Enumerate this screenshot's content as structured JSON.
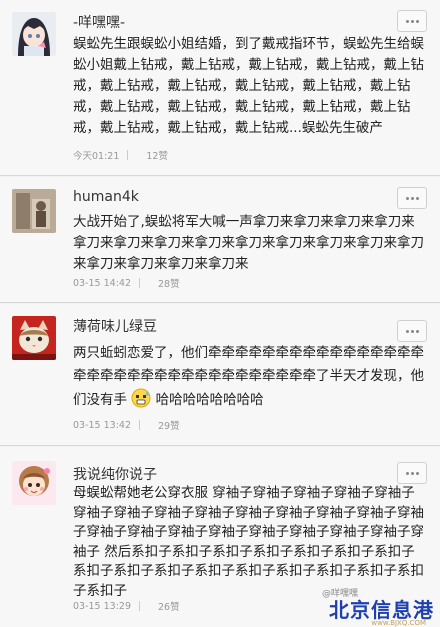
{
  "posts": [
    {
      "username": "-咩嘿嘿-",
      "content": "蜈蚣先生跟蜈蚣小姐结婚，到了戴戒指环节，蜈蚣先生给蜈蚣小姐戴上钻戒，戴上钻戒，戴上钻戒，戴上钻戒，戴上钻戒，戴上钻戒，戴上钻戒，戴上钻戒，戴上钻戒，戴上钻戒，戴上钻戒，戴上钻戒，戴上钻戒，戴上钻戒，戴上钻戒，戴上钻戒，戴上钻戒，戴上钻戒...蜈蚣先生破产",
      "time": "今天01:21",
      "likes": "12赞"
    },
    {
      "username": "human4k",
      "content": "大战开始了,蜈蚣将军大喊一声拿刀来拿刀来拿刀来拿刀来拿刀来拿刀来拿刀来拿刀来拿刀来拿刀来拿刀来拿刀来拿刀来拿刀来拿刀来拿刀来拿刀来",
      "time": "03-15 14:42",
      "likes": "28赞"
    },
    {
      "username": "薄荷味儿绿豆",
      "content_before": "两只蚯蚓恋爱了，他们牵牵牵牵牵牵牵牵牵牵牵牵牵牵牵牵牵牵牵牵牵牵牵牵牵牵牵牵牵牵牵牵牵牵了半天才发现，他们没有手",
      "content_after": "哈哈哈哈哈哈哈哈",
      "time": "03-15 13:42",
      "likes": "29赞"
    },
    {
      "username": "我说纯你说子",
      "content": "母蜈蚣帮她老公穿衣服 穿袖子穿袖子穿袖子穿袖子穿袖子穿袖子穿袖子穿袖子穿袖子穿袖子穿袖子穿袖子穿袖子穿袖子穿袖子穿袖子穿袖子穿袖子穿袖子穿袖子穿袖子穿袖子穿袖子 然后系扣子系扣子系扣子系扣子系扣子系扣子系扣子系扣子系扣子系扣子系扣子系扣子系扣子系扣子系扣子系扣子系扣子",
      "time": "03-15 13:29",
      "likes": "26赞"
    }
  ],
  "watermark": {
    "text": "北京信息港",
    "url": "www.BJXQ.COM",
    "tag": "@咩嘿嘿"
  },
  "colors": {
    "background": "#f2f2f2",
    "card": "#f7f7f7",
    "text": "#222222",
    "meta": "#999999",
    "watermark": "#1f3fae"
  },
  "icons": [
    "more-icon",
    "avatar-anime-girl",
    "avatar-photo",
    "avatar-cat",
    "avatar-cartoon-girl",
    "sweat-smile-emoji"
  ]
}
